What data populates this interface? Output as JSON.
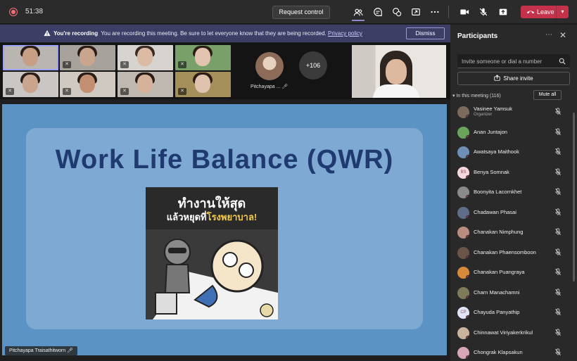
{
  "topbar": {
    "timer": "51:38",
    "request_control": "Request control",
    "leave": "Leave"
  },
  "banner": {
    "bold": "You're recording",
    "text": "You are recording this meeting. Be sure to let everyone know that they are being recorded.",
    "link": "Privacy policy",
    "dismiss": "Dismiss"
  },
  "gallery": {
    "pinned_name": "Pitchayapa ...",
    "overflow_count": "+106"
  },
  "slide": {
    "title": "Work Life Balance (QWR)",
    "poster_line1": "ทำงานให้สุด",
    "poster_line2a": "แล้วหยุดที่",
    "poster_line2b": "โรงพยาบาล!"
  },
  "presenter_label": "Pitchayapa Traisathitworn",
  "panel": {
    "title": "Participants",
    "invite_placeholder": "Invite someone or dial a number",
    "share_invite": "Share invite",
    "in_meeting": "In this meeting (116)",
    "mute_all": "Mute all",
    "participants": [
      {
        "name": "Vasinee Yamsuk",
        "role": "Organizer",
        "avatar_color": "#7d6a5e"
      },
      {
        "name": "Anan Juntajon",
        "role": "",
        "avatar_color": "#6aa35c"
      },
      {
        "name": "Awatsaya Maithook",
        "role": "",
        "avatar_color": "#6f8fb8"
      },
      {
        "name": "Benya Somnak",
        "role": "",
        "initials": "BS",
        "avatar_color": "#f6d9de"
      },
      {
        "name": "Boonyita Lacornkhet",
        "role": "",
        "avatar_color": "#8a8a8a"
      },
      {
        "name": "Chadawan Phasai",
        "role": "",
        "avatar_color": "#5e6e8a"
      },
      {
        "name": "Chanakan Nimphung",
        "role": "",
        "avatar_color": "#b98c80"
      },
      {
        "name": "Chanakan Phaensomboon",
        "role": "",
        "avatar_color": "#6b5448"
      },
      {
        "name": "Chanakan Puangraya",
        "role": "",
        "avatar_color": "#d88a3a"
      },
      {
        "name": "Charn Manachamni",
        "role": "",
        "avatar_color": "#7f7a5a"
      },
      {
        "name": "Chayuda Panyathip",
        "role": "",
        "initials": "CP",
        "avatar_color": "#e1e6f7"
      },
      {
        "name": "Chinnawat Viriyakerkrikul",
        "role": "",
        "avatar_color": "#c9b39c"
      },
      {
        "name": "Chongrak Klapsakun",
        "role": "",
        "avatar_color": "#d7a7b7"
      }
    ]
  }
}
